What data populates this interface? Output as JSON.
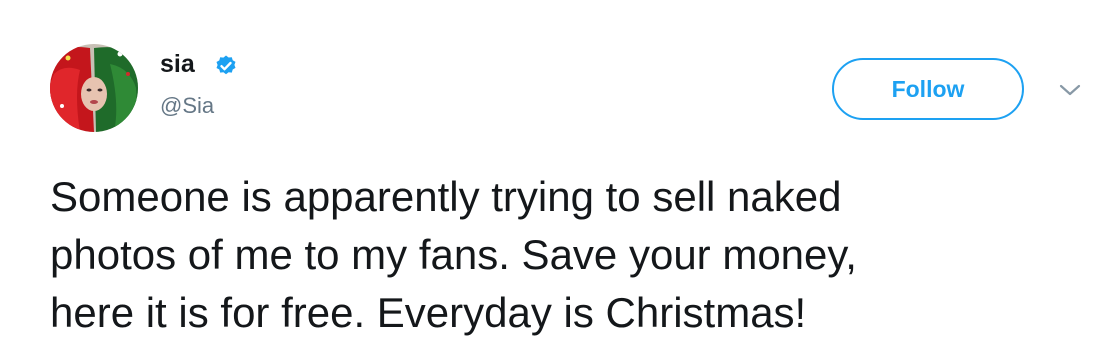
{
  "tweet": {
    "display_name": "sia",
    "handle": "@Sia",
    "follow_label": "Follow",
    "text": "Someone is apparently trying to sell naked\nphotos of me to my fans. Save your money,\nhere it is for free. Everyday is Christmas!"
  },
  "icons": {
    "verified": "verified-badge-icon",
    "caret": "chevron-down-icon",
    "avatar": "profile-avatar"
  },
  "colors": {
    "accent": "#1da1f2",
    "text": "#14171a",
    "secondary_text": "#657786"
  }
}
